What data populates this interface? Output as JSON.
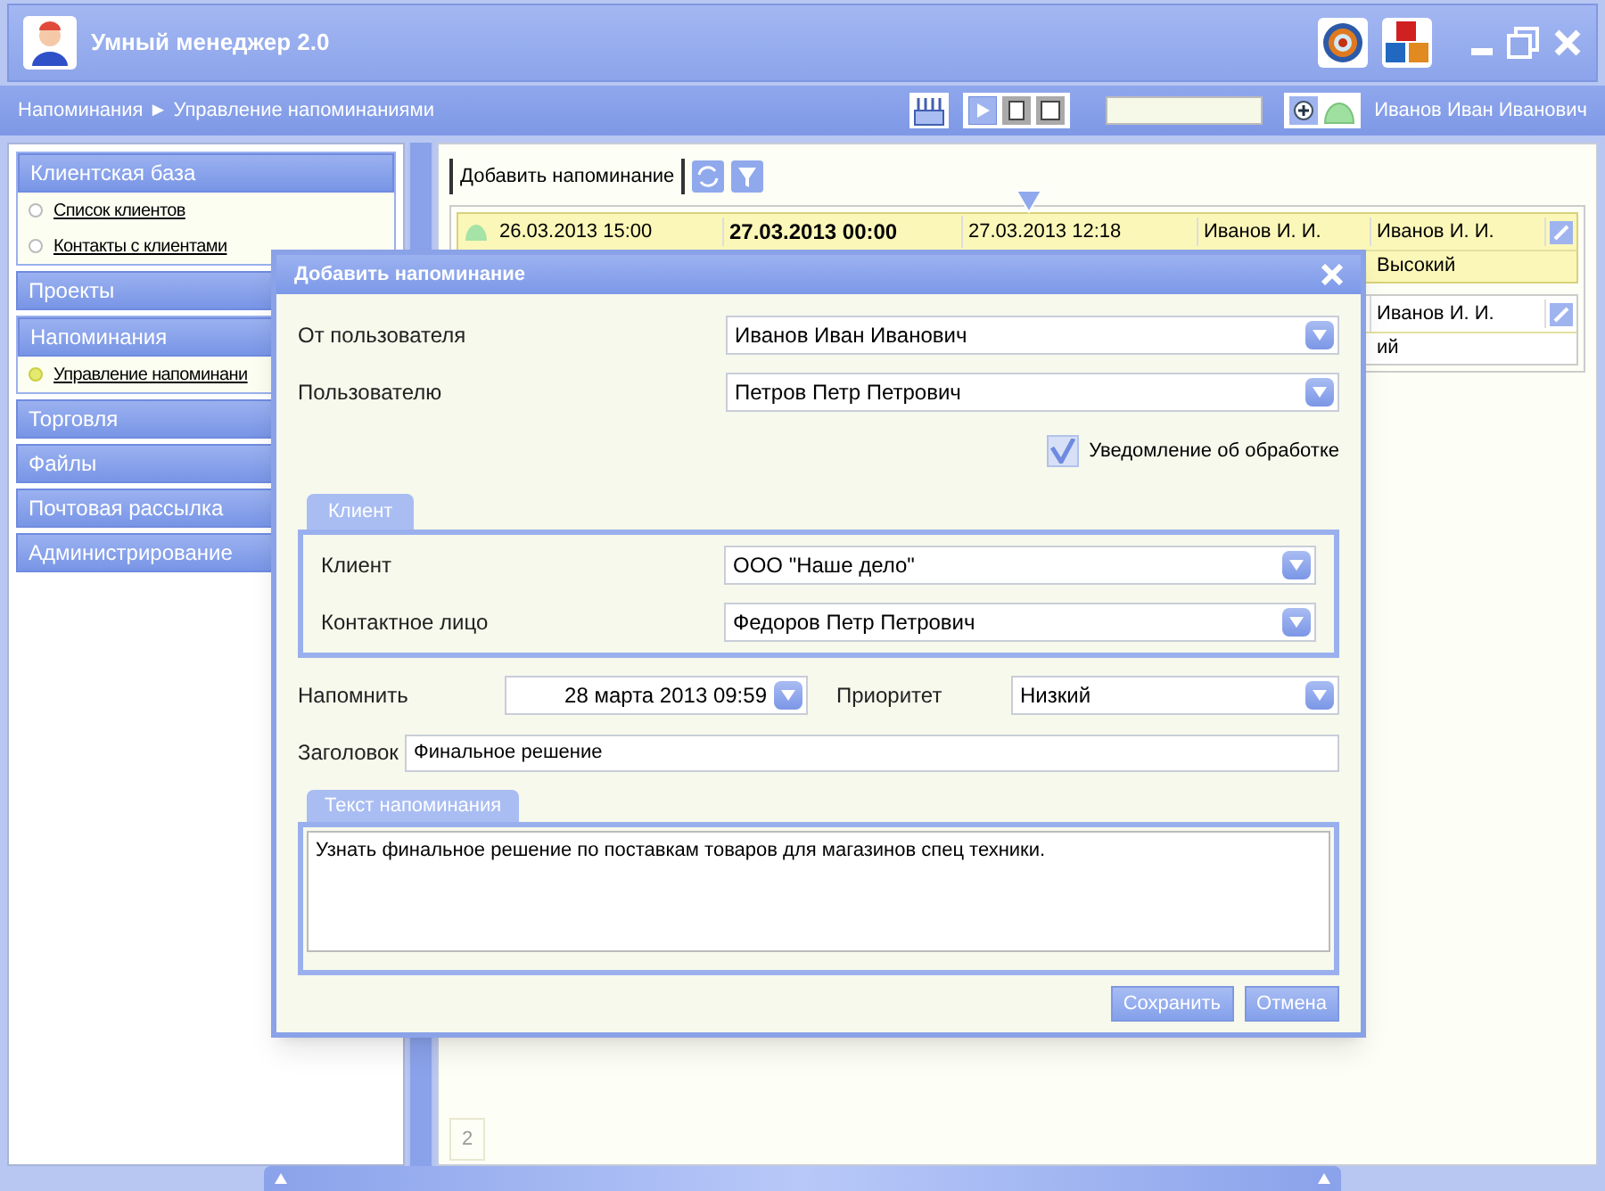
{
  "window": {
    "title": "Умный менеджер 2.0"
  },
  "breadcrumb": "Напоминания ► Управление напоминаниями",
  "user": "Иванов Иван Иванович",
  "sidebar": [
    {
      "title": "Клиентская база",
      "expanded": true,
      "items": [
        {
          "label": "Список клиентов",
          "selected": false
        },
        {
          "label": "Контакты с клиентами",
          "selected": false
        }
      ]
    },
    {
      "title": "Проекты",
      "expanded": false
    },
    {
      "title": "Напоминания",
      "expanded": true,
      "items": [
        {
          "label": "Управление напоминани",
          "selected": true
        }
      ]
    },
    {
      "title": "Торговля",
      "expanded": false
    },
    {
      "title": "Файлы",
      "expanded": false
    },
    {
      "title": "Почтовая рассылка",
      "expanded": false
    },
    {
      "title": "Администрирование",
      "expanded": false
    }
  ],
  "content": {
    "add_button": "Добавить напоминание",
    "rows": [
      {
        "highlighted": true,
        "cells": [
          "26.03.2013 15:00",
          "27.03.2013 00:00",
          "27.03.2013 12:18",
          "Иванов И. И.",
          "Иванов И. И."
        ],
        "priority": "Высокий"
      },
      {
        "highlighted": false,
        "cells": [
          "",
          "",
          "",
          "",
          "Иванов И. И."
        ],
        "priority": "ий"
      }
    ],
    "page": "2"
  },
  "dialog": {
    "title": "Добавить напоминание",
    "from_user": {
      "label": "От пользователя",
      "value": "Иванов Иван Иванович"
    },
    "to_user": {
      "label": "Пользователю",
      "value": "Петров Петр Петрович"
    },
    "notify": {
      "label": "Уведомление об обработке",
      "checked": true
    },
    "client_tab": "Клиент",
    "client": {
      "label": "Клиент",
      "value": "ООО \"Наше дело\""
    },
    "contact": {
      "label": "Контактное лицо",
      "value": "Федоров Петр Петрович"
    },
    "remind": {
      "label": "Напомнить",
      "value": "28 марта 2013 09:59"
    },
    "priority": {
      "label": "Приоритет",
      "value": "Низкий"
    },
    "subject": {
      "label": "Заголовок",
      "value": "Финальное решение"
    },
    "text_tab": "Текст напоминания",
    "text": "Узнать финальное решение по поставкам товаров для магазинов спец техники.",
    "buttons": [
      "Сохранить",
      "Отмена"
    ]
  }
}
